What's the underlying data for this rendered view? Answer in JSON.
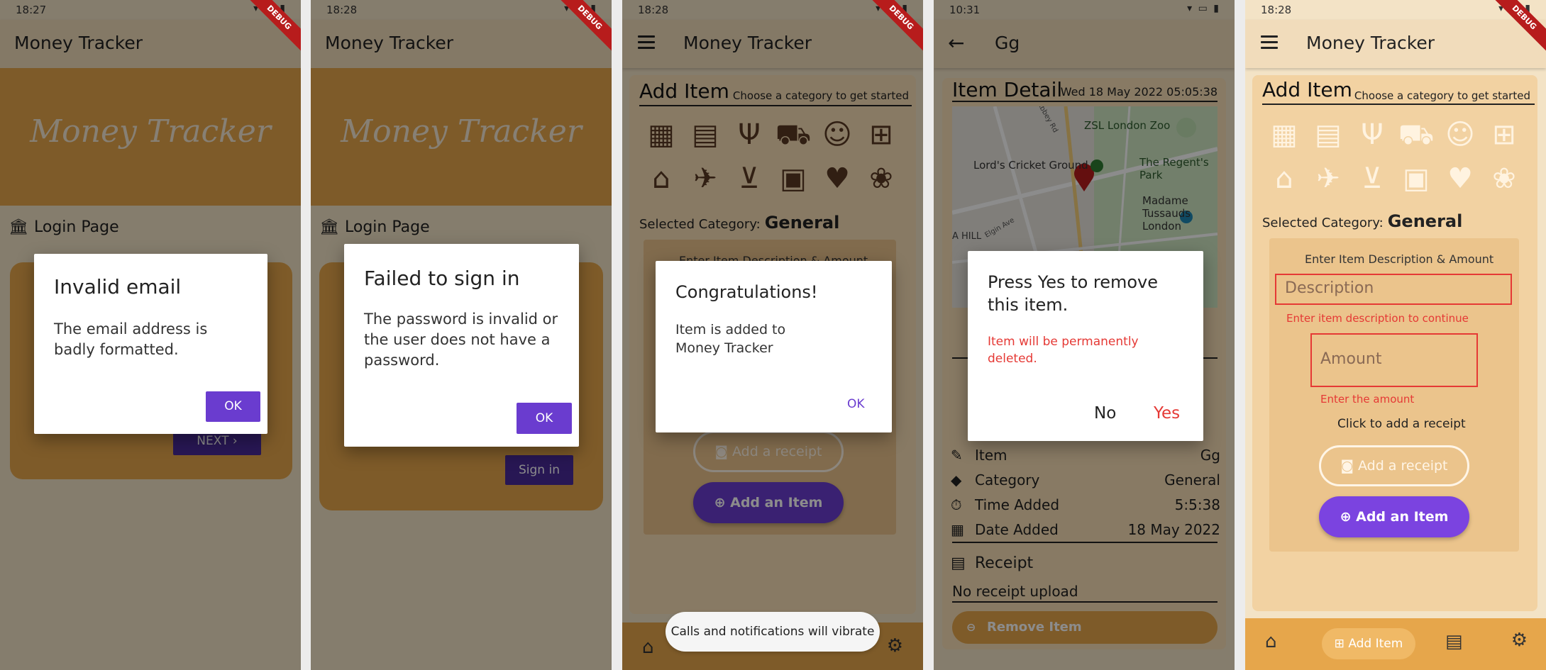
{
  "app_name": "Money Tracker",
  "debug_label": "DEBUG",
  "phones": [
    {
      "status_time": "18:27",
      "banner_title": "Money Tracker",
      "login_label": "Login Page",
      "next_label": "NEXT",
      "dialog": {
        "title": "Invalid email",
        "body": "The email address is badly formatted.",
        "ok": "OK"
      }
    },
    {
      "status_time": "18:28",
      "banner_title": "Money Tracker",
      "login_label": "Login Page",
      "signin_label": "Sign in",
      "dialog": {
        "title": "Failed to sign in",
        "body": "The password is invalid or the user does not have a password.",
        "ok": "OK"
      }
    },
    {
      "status_time": "18:28",
      "section_title": "Add Item",
      "section_sub": "Choose a category to get started",
      "selected_label": "Selected Category:",
      "selected_value": "General",
      "form_hint": "Enter Item Description & Amount",
      "receipt_btn": "Add a receipt",
      "add_btn": "Add an Item",
      "dialog": {
        "title": "Congratulations!",
        "body": "Item is added to Money Tracker",
        "ok": "OK"
      },
      "snackbar": "Calls and notifications will vibrate"
    },
    {
      "status_time": "10:31",
      "title": "Gg",
      "section_title": "Item Detail",
      "timestamp": "Wed  18 May 2022  05:05:38",
      "map_labels": {
        "zoo": "ZSL London Zoo",
        "cricket": "Lord's Cricket Ground",
        "park": "The Regent's Park",
        "tussauds": "Madame Tussauds London",
        "abbey": "Abbey Rd",
        "elgin": "Elgin Ave",
        "hill": "A HILL"
      },
      "rows": [
        {
          "label": "Item",
          "value": "Gg"
        },
        {
          "label": "Category",
          "value": "General"
        },
        {
          "label": "Time Added",
          "value": "5:5:38"
        },
        {
          "label": "Date Added",
          "value": "18 May 2022"
        }
      ],
      "receipt_label": "Receipt",
      "no_receipt": "No receipt upload",
      "remove_btn": "Remove Item",
      "dialog": {
        "title": "Press Yes to remove this item.",
        "body": "Item will be permanently deleted.",
        "no": "No",
        "yes": "Yes"
      }
    },
    {
      "status_time": "18:28",
      "section_title": "Add Item",
      "section_sub": "Choose a category to get started",
      "selected_label": "Selected Category:",
      "selected_value": "General",
      "form_hint": "Enter Item Description & Amount",
      "desc_placeholder": "Description",
      "desc_error": "Enter item description to continue",
      "amount_placeholder": "Amount",
      "amount_error": "Enter the amount",
      "receipt_hint": "Click to add a receipt",
      "receipt_btn": "Add a receipt",
      "add_btn": "Add an Item",
      "nav_add": "Add Item"
    }
  ],
  "colors": {
    "accent": "#6a3ccf",
    "brand": "#e6a64b",
    "error": "#e53935",
    "appbar": "#f1dcbb"
  },
  "category_icons": [
    "dashboard-icon",
    "receipt-icon",
    "restaurant-icon",
    "delivery-icon",
    "smile-icon",
    "gift-icon",
    "store-icon",
    "airplane-icon",
    "cart-icon",
    "bus-icon",
    "heart-icon",
    "paw-icon"
  ]
}
